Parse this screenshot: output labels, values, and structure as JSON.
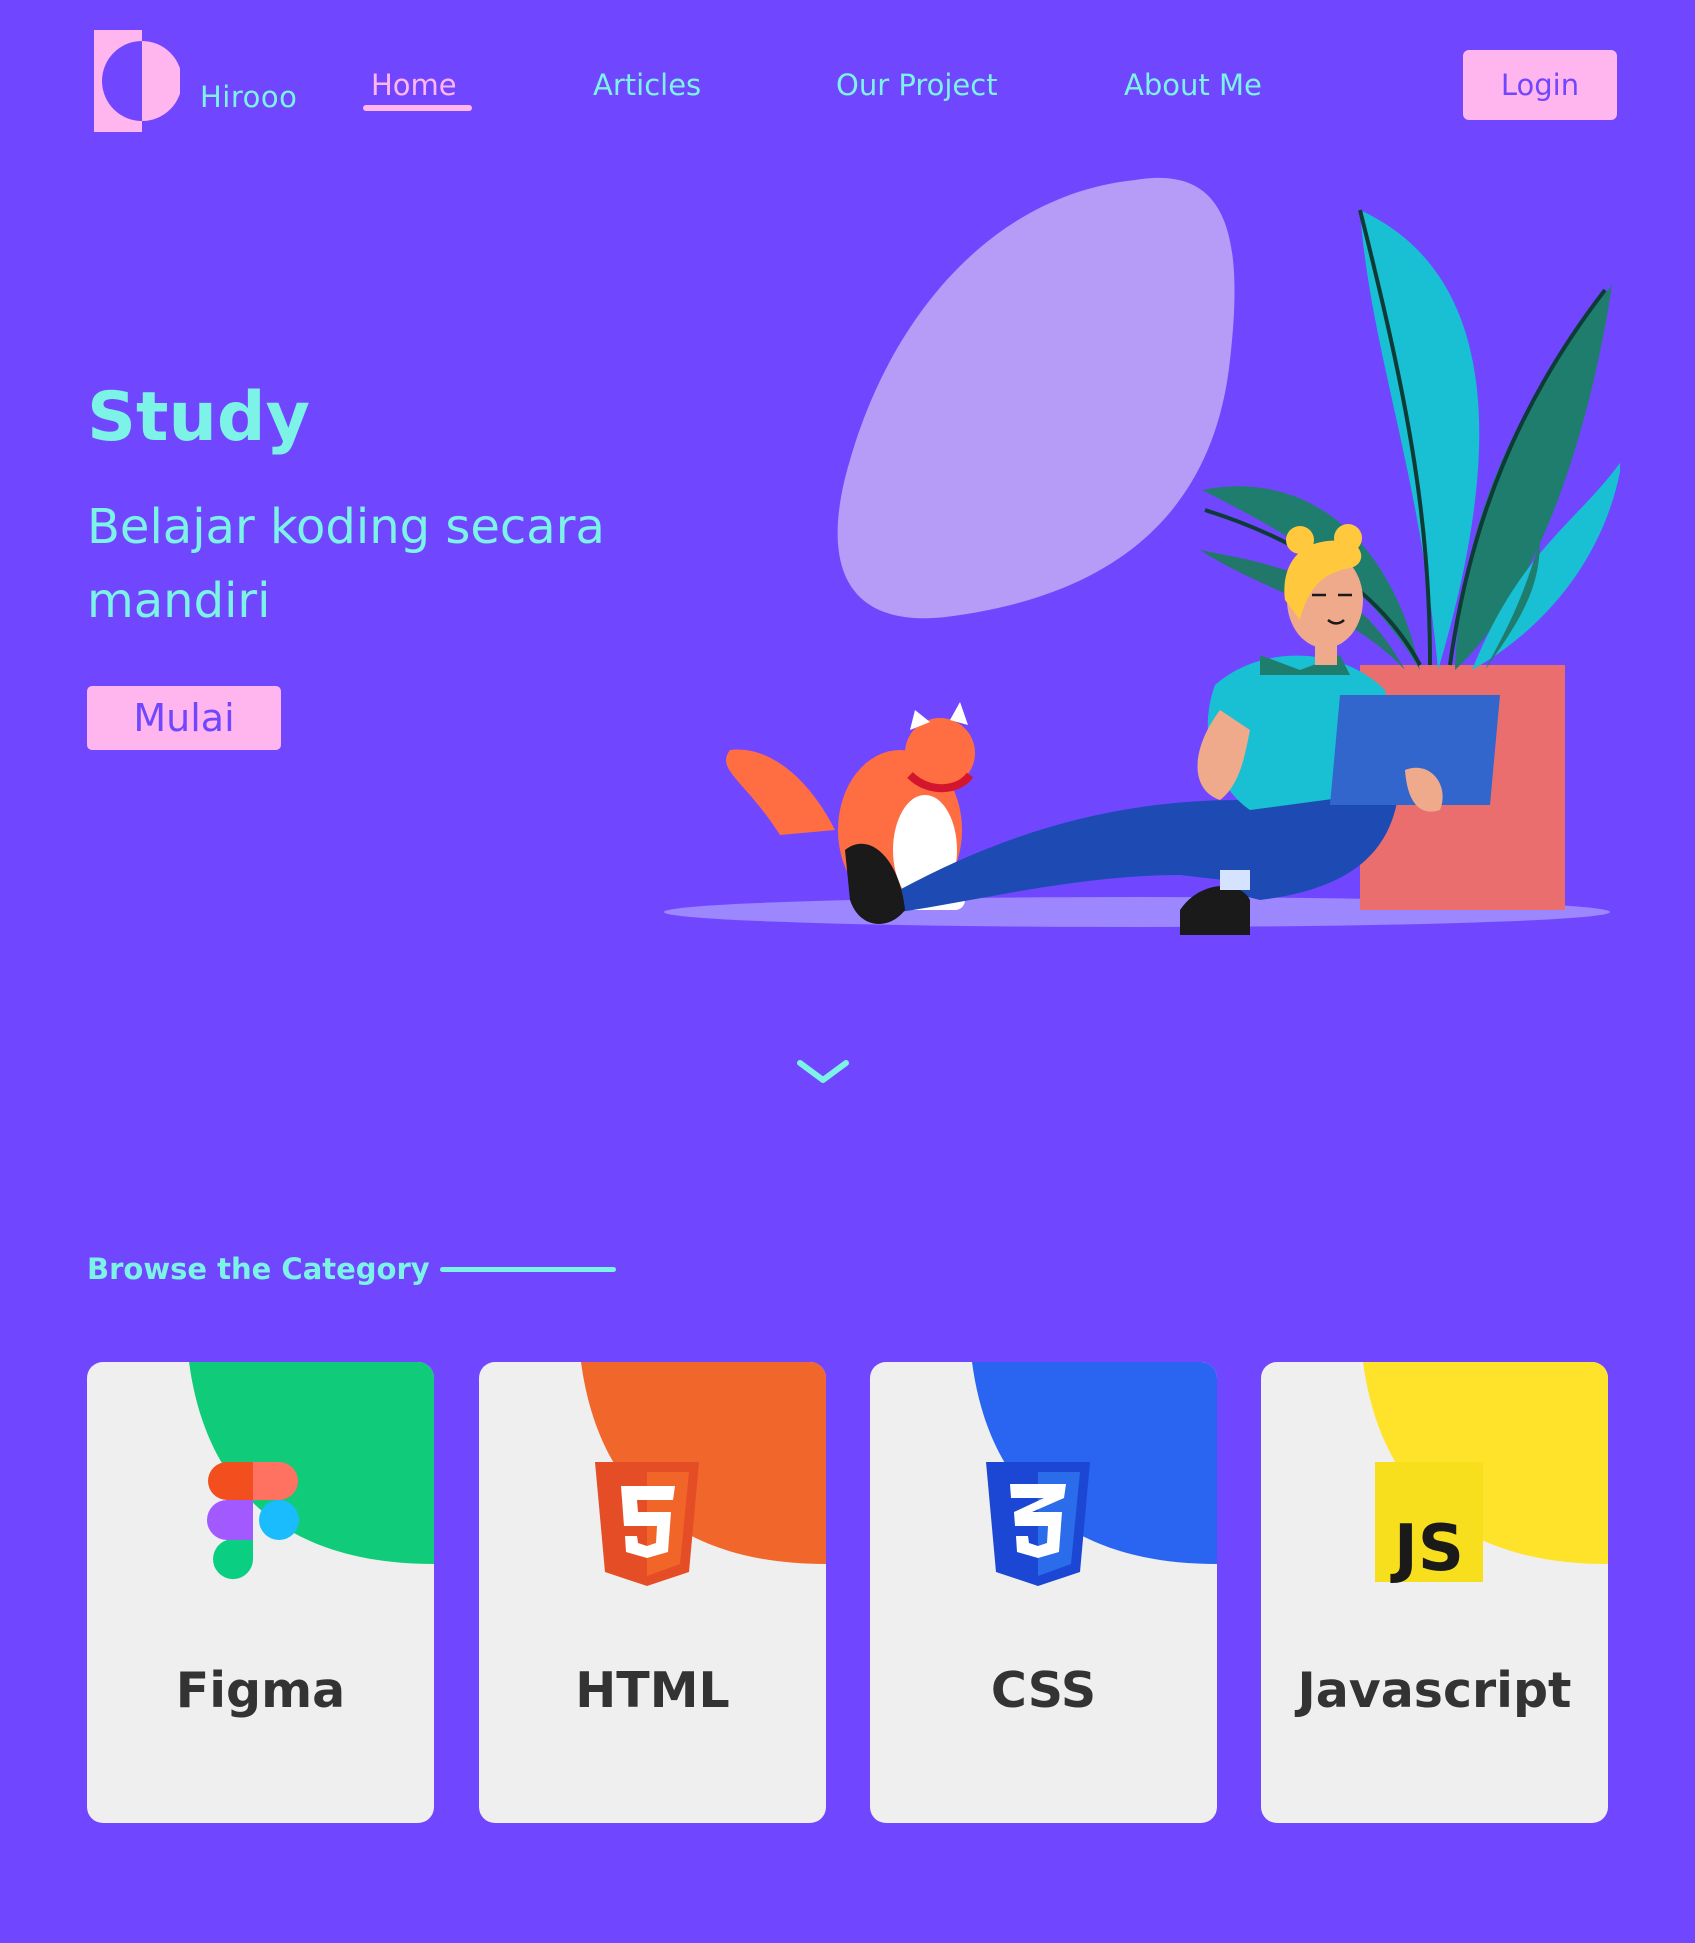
{
  "header": {
    "brand": "Hirooo",
    "nav": [
      {
        "label": "Home",
        "active": true
      },
      {
        "label": "Articles",
        "active": false
      },
      {
        "label": "Our Project",
        "active": false
      },
      {
        "label": "About Me",
        "active": false
      }
    ],
    "login_label": "Login"
  },
  "hero": {
    "title": "Study",
    "subtitle": "Belajar koding secara mandiri",
    "cta_label": "Mulai"
  },
  "category": {
    "title": "Browse the Category",
    "cards": [
      {
        "label": "Figma",
        "icon": "figma-icon",
        "color": "#10CC7A"
      },
      {
        "label": "HTML",
        "icon": "html5-icon",
        "color": "#F1662A"
      },
      {
        "label": "CSS",
        "icon": "css3-icon",
        "color": "#2965F1"
      },
      {
        "label": "Javascript",
        "icon": "js-icon",
        "color": "#FFE22A"
      }
    ]
  },
  "icons": {
    "scroll": "chevron-down-icon",
    "illustration_text": "JS"
  },
  "colors": {
    "background": "#7047FF",
    "accent": "#7CF3E6",
    "pink": "#FFB6EE",
    "card": "#EFEFEF",
    "card_text": "#333333"
  }
}
